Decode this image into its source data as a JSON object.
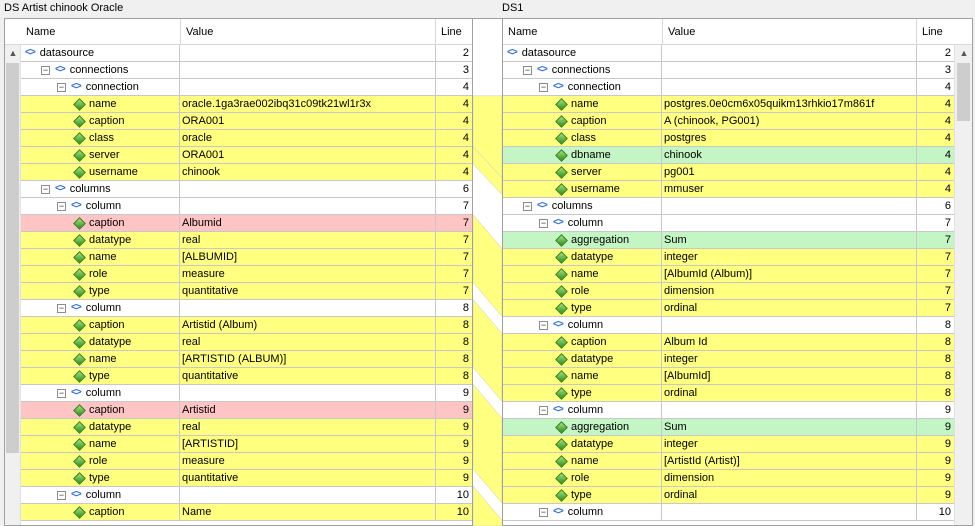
{
  "left": {
    "title": "DS Artist chinook Oracle",
    "headers": {
      "name": "Name",
      "value": "Value",
      "line": "Line"
    },
    "rows": [
      {
        "lvl": 0,
        "node": "bracket",
        "exp": null,
        "name": "datasource",
        "value": "",
        "line": "2",
        "color": "white"
      },
      {
        "lvl": 1,
        "node": "bracket",
        "exp": "⊟",
        "name": "connections",
        "value": "",
        "line": "3",
        "color": "white"
      },
      {
        "lvl": 2,
        "node": "bracket",
        "exp": "⊟",
        "name": "connection",
        "value": "",
        "line": "4",
        "color": "white"
      },
      {
        "lvl": 3,
        "node": "attr",
        "exp": null,
        "name": "name",
        "value": "oracle.1ga3rae002ibq31c09tk21wl1r3x",
        "line": "4",
        "color": "yellow"
      },
      {
        "lvl": 3,
        "node": "attr",
        "exp": null,
        "name": "caption",
        "value": "ORA001",
        "line": "4",
        "color": "yellow"
      },
      {
        "lvl": 3,
        "node": "attr",
        "exp": null,
        "name": "class",
        "value": "oracle",
        "line": "4",
        "color": "yellow"
      },
      {
        "lvl": 3,
        "node": "attr",
        "exp": null,
        "name": "server",
        "value": "ORA001",
        "line": "4",
        "color": "yellow"
      },
      {
        "lvl": 3,
        "node": "attr",
        "exp": null,
        "name": "username",
        "value": "chinook",
        "line": "4",
        "color": "yellow"
      },
      {
        "lvl": 1,
        "node": "bracket",
        "exp": "⊟",
        "name": "columns",
        "value": "",
        "line": "6",
        "color": "white"
      },
      {
        "lvl": 2,
        "node": "bracket",
        "exp": "⊟",
        "name": "column",
        "value": "",
        "line": "7",
        "color": "white"
      },
      {
        "lvl": 3,
        "node": "attr",
        "exp": null,
        "name": "caption",
        "value": "Albumid",
        "line": "7",
        "color": "red"
      },
      {
        "lvl": 3,
        "node": "attr",
        "exp": null,
        "name": "datatype",
        "value": "real",
        "line": "7",
        "color": "yellow"
      },
      {
        "lvl": 3,
        "node": "attr",
        "exp": null,
        "name": "name",
        "value": "[ALBUMID]",
        "line": "7",
        "color": "yellow"
      },
      {
        "lvl": 3,
        "node": "attr",
        "exp": null,
        "name": "role",
        "value": "measure",
        "line": "7",
        "color": "yellow"
      },
      {
        "lvl": 3,
        "node": "attr",
        "exp": null,
        "name": "type",
        "value": "quantitative",
        "line": "7",
        "color": "yellow"
      },
      {
        "lvl": 2,
        "node": "bracket",
        "exp": "⊟",
        "name": "column",
        "value": "",
        "line": "8",
        "color": "white"
      },
      {
        "lvl": 3,
        "node": "attr",
        "exp": null,
        "name": "caption",
        "value": "Artistid (Album)",
        "line": "8",
        "color": "yellow"
      },
      {
        "lvl": 3,
        "node": "attr",
        "exp": null,
        "name": "datatype",
        "value": "real",
        "line": "8",
        "color": "yellow"
      },
      {
        "lvl": 3,
        "node": "attr",
        "exp": null,
        "name": "name",
        "value": "[ARTISTID (ALBUM)]",
        "line": "8",
        "color": "yellow"
      },
      {
        "lvl": 3,
        "node": "attr",
        "exp": null,
        "name": "type",
        "value": "quantitative",
        "line": "8",
        "color": "yellow"
      },
      {
        "lvl": 2,
        "node": "bracket",
        "exp": "⊟",
        "name": "column",
        "value": "",
        "line": "9",
        "color": "white"
      },
      {
        "lvl": 3,
        "node": "attr",
        "exp": null,
        "name": "caption",
        "value": "Artistid",
        "line": "9",
        "color": "red"
      },
      {
        "lvl": 3,
        "node": "attr",
        "exp": null,
        "name": "datatype",
        "value": "real",
        "line": "9",
        "color": "yellow"
      },
      {
        "lvl": 3,
        "node": "attr",
        "exp": null,
        "name": "name",
        "value": "[ARTISTID]",
        "line": "9",
        "color": "yellow"
      },
      {
        "lvl": 3,
        "node": "attr",
        "exp": null,
        "name": "role",
        "value": "measure",
        "line": "9",
        "color": "yellow"
      },
      {
        "lvl": 3,
        "node": "attr",
        "exp": null,
        "name": "type",
        "value": "quantitative",
        "line": "9",
        "color": "yellow"
      },
      {
        "lvl": 2,
        "node": "bracket",
        "exp": "⊟",
        "name": "column",
        "value": "",
        "line": "10",
        "color": "white"
      },
      {
        "lvl": 3,
        "node": "attr",
        "exp": null,
        "name": "caption",
        "value": "Name",
        "line": "10",
        "color": "yellow"
      }
    ]
  },
  "right": {
    "title": "DS1",
    "headers": {
      "name": "Name",
      "value": "Value",
      "line": "Line"
    },
    "rows": [
      {
        "lvl": 0,
        "node": "bracket",
        "exp": null,
        "name": "datasource",
        "value": "",
        "line": "2",
        "color": "white"
      },
      {
        "lvl": 1,
        "node": "bracket",
        "exp": "⊟",
        "name": "connections",
        "value": "",
        "line": "3",
        "color": "white"
      },
      {
        "lvl": 2,
        "node": "bracket",
        "exp": "⊟",
        "name": "connection",
        "value": "",
        "line": "4",
        "color": "white"
      },
      {
        "lvl": 3,
        "node": "attr",
        "exp": null,
        "name": "name",
        "value": "postgres.0e0cm6x05quikm13rhkio17m861f",
        "line": "4",
        "color": "yellow"
      },
      {
        "lvl": 3,
        "node": "attr",
        "exp": null,
        "name": "caption",
        "value": "A (chinook, PG001)",
        "line": "4",
        "color": "yellow"
      },
      {
        "lvl": 3,
        "node": "attr",
        "exp": null,
        "name": "class",
        "value": "postgres",
        "line": "4",
        "color": "yellow"
      },
      {
        "lvl": 3,
        "node": "attr",
        "exp": null,
        "name": "dbname",
        "value": "chinook",
        "line": "4",
        "color": "green"
      },
      {
        "lvl": 3,
        "node": "attr",
        "exp": null,
        "name": "server",
        "value": "pg001",
        "line": "4",
        "color": "yellow"
      },
      {
        "lvl": 3,
        "node": "attr",
        "exp": null,
        "name": "username",
        "value": "mmuser",
        "line": "4",
        "color": "yellow"
      },
      {
        "lvl": 1,
        "node": "bracket",
        "exp": "⊟",
        "name": "columns",
        "value": "",
        "line": "6",
        "color": "white"
      },
      {
        "lvl": 2,
        "node": "bracket",
        "exp": "⊟",
        "name": "column",
        "value": "",
        "line": "7",
        "color": "white"
      },
      {
        "lvl": 3,
        "node": "attr",
        "exp": null,
        "name": "aggregation",
        "value": "Sum",
        "line": "7",
        "color": "green"
      },
      {
        "lvl": 3,
        "node": "attr",
        "exp": null,
        "name": "datatype",
        "value": "integer",
        "line": "7",
        "color": "yellow"
      },
      {
        "lvl": 3,
        "node": "attr",
        "exp": null,
        "name": "name",
        "value": "[AlbumId (Album)]",
        "line": "7",
        "color": "yellow"
      },
      {
        "lvl": 3,
        "node": "attr",
        "exp": null,
        "name": "role",
        "value": "dimension",
        "line": "7",
        "color": "yellow"
      },
      {
        "lvl": 3,
        "node": "attr",
        "exp": null,
        "name": "type",
        "value": "ordinal",
        "line": "7",
        "color": "yellow"
      },
      {
        "lvl": 2,
        "node": "bracket",
        "exp": "⊟",
        "name": "column",
        "value": "",
        "line": "8",
        "color": "white"
      },
      {
        "lvl": 3,
        "node": "attr",
        "exp": null,
        "name": "caption",
        "value": "Album Id",
        "line": "8",
        "color": "yellow"
      },
      {
        "lvl": 3,
        "node": "attr",
        "exp": null,
        "name": "datatype",
        "value": "integer",
        "line": "8",
        "color": "yellow"
      },
      {
        "lvl": 3,
        "node": "attr",
        "exp": null,
        "name": "name",
        "value": "[AlbumId]",
        "line": "8",
        "color": "yellow"
      },
      {
        "lvl": 3,
        "node": "attr",
        "exp": null,
        "name": "type",
        "value": "ordinal",
        "line": "8",
        "color": "yellow"
      },
      {
        "lvl": 2,
        "node": "bracket",
        "exp": "⊟",
        "name": "column",
        "value": "",
        "line": "9",
        "color": "white"
      },
      {
        "lvl": 3,
        "node": "attr",
        "exp": null,
        "name": "aggregation",
        "value": "Sum",
        "line": "9",
        "color": "green"
      },
      {
        "lvl": 3,
        "node": "attr",
        "exp": null,
        "name": "datatype",
        "value": "integer",
        "line": "9",
        "color": "yellow"
      },
      {
        "lvl": 3,
        "node": "attr",
        "exp": null,
        "name": "name",
        "value": "[ArtistId (Artist)]",
        "line": "9",
        "color": "yellow"
      },
      {
        "lvl": 3,
        "node": "attr",
        "exp": null,
        "name": "role",
        "value": "dimension",
        "line": "9",
        "color": "yellow"
      },
      {
        "lvl": 3,
        "node": "attr",
        "exp": null,
        "name": "type",
        "value": "ordinal",
        "line": "9",
        "color": "yellow"
      },
      {
        "lvl": 2,
        "node": "bracket",
        "exp": "⊟",
        "name": "column",
        "value": "",
        "line": "10",
        "color": "white"
      }
    ]
  },
  "colors": {
    "yellow": "#ffff80",
    "red": "#ffc4c4",
    "green": "#c4f5c4"
  }
}
